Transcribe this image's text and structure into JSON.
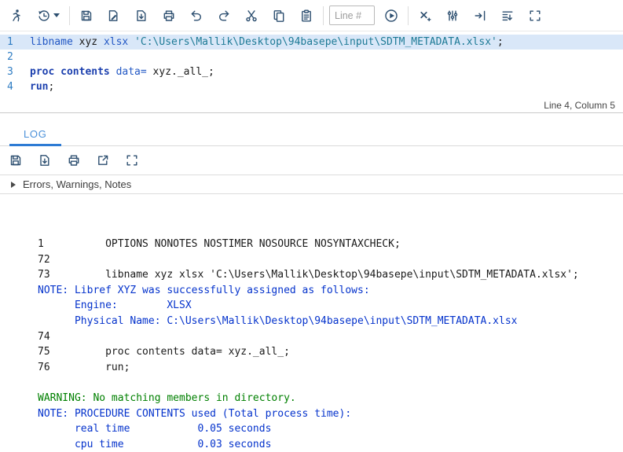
{
  "app": {
    "name": "SAS Studio code editor with log"
  },
  "top_toolbar": {
    "icons": [
      "running-man-icon",
      "submission-history-icon",
      "chevron-down-icon",
      "save-icon",
      "save-as-icon",
      "download-icon",
      "print-icon",
      "undo-icon",
      "redo-icon",
      "cut-icon",
      "copy-icon",
      "paste-icon",
      "go-to-line-icon",
      "clear-code-icon",
      "format-code-icon",
      "indent-icon",
      "code-outline-icon",
      "maximize-view-icon"
    ],
    "line_number_placeholder": "Line #",
    "line_number_value": ""
  },
  "editor": {
    "status_text": "Line 4, Column 5",
    "lines": [
      {
        "number": "1",
        "selected": true,
        "tokens": [
          {
            "t": "kw",
            "text": "libname"
          },
          {
            "t": "plain",
            "text": " xyz "
          },
          {
            "t": "kw",
            "text": "xlsx"
          },
          {
            "t": "plain",
            "text": " "
          },
          {
            "t": "str",
            "text": "'C:\\Users\\Mallik\\Desktop\\94basepe\\input\\SDTM_METADATA.xlsx'"
          },
          {
            "t": "plain",
            "text": ";"
          }
        ]
      },
      {
        "number": "2",
        "selected": false,
        "tokens": []
      },
      {
        "number": "3",
        "selected": false,
        "tokens": [
          {
            "t": "proc",
            "text": "proc contents"
          },
          {
            "t": "plain",
            "text": " "
          },
          {
            "t": "kw",
            "text": "data="
          },
          {
            "t": "plain",
            "text": " xyz._all_;"
          }
        ]
      },
      {
        "number": "4",
        "selected": false,
        "tokens": [
          {
            "t": "proc",
            "text": "run"
          },
          {
            "t": "plain",
            "text": ";"
          }
        ]
      }
    ]
  },
  "log": {
    "tab_label": "LOG",
    "toolbar_icons": [
      "save-log-icon",
      "download-log-icon",
      "print-log-icon",
      "open-new-window-icon",
      "maximize-view-icon"
    ],
    "messages_label": "Errors, Warnings, Notes",
    "lines": [
      {
        "type": "code",
        "text": "1          OPTIONS NONOTES NOSTIMER NOSOURCE NOSYNTAXCHECK;"
      },
      {
        "type": "code",
        "text": "72         "
      },
      {
        "type": "code",
        "text": "73         libname xyz xlsx 'C:\\Users\\Mallik\\Desktop\\94basepe\\input\\SDTM_METADATA.xlsx';"
      },
      {
        "type": "note",
        "text": "NOTE: Libref XYZ was successfully assigned as follows:"
      },
      {
        "type": "note",
        "text": "      Engine:        XLSX"
      },
      {
        "type": "note",
        "text": "      Physical Name: C:\\Users\\Mallik\\Desktop\\94basepe\\input\\SDTM_METADATA.xlsx"
      },
      {
        "type": "code",
        "text": "74         "
      },
      {
        "type": "code",
        "text": "75         proc contents data= xyz._all_;"
      },
      {
        "type": "code",
        "text": "76         run;"
      },
      {
        "type": "blank",
        "text": ""
      },
      {
        "type": "warning",
        "text": "WARNING: No matching members in directory."
      },
      {
        "type": "note",
        "text": "NOTE: PROCEDURE CONTENTS used (Total process time):"
      },
      {
        "type": "note",
        "text": "      real time           0.05 seconds"
      },
      {
        "type": "note",
        "text": "      cpu time            0.03 seconds"
      }
    ]
  },
  "colors": {
    "icon": "#2d4f70",
    "accent_blue": "#2d7bd4",
    "tab_text": "#4a90d9",
    "keyword": "#2157c4",
    "statement_bold": "#1b3fae",
    "string_literal": "#1d7a96",
    "selected_line_bg": "#d9e7f8",
    "line_number": "#2e7cc3",
    "log_note": "#0533cc",
    "log_warning": "#008000"
  }
}
